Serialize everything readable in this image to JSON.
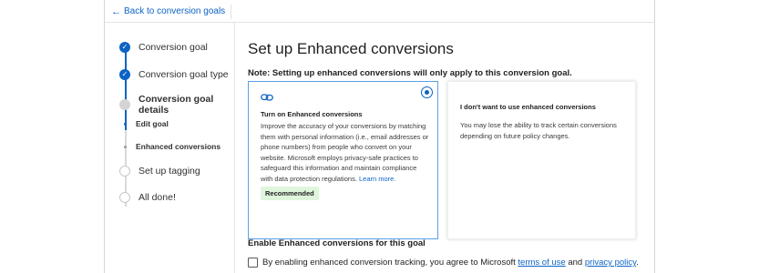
{
  "topbar": {
    "back_label": "Back to conversion goals"
  },
  "sidebar": {
    "steps": [
      {
        "label": "Conversion goal",
        "state": "done"
      },
      {
        "label": "Conversion goal type",
        "state": "done"
      },
      {
        "label": "Conversion goal details",
        "state": "current"
      },
      {
        "label": "Set up tagging",
        "state": "todo"
      },
      {
        "label": "All done!",
        "state": "todo"
      }
    ],
    "substeps": [
      {
        "label": "Edit goal",
        "state": "done"
      },
      {
        "label": "Enhanced conversions",
        "state": "current"
      }
    ]
  },
  "main": {
    "title": "Set up Enhanced conversions",
    "note": "Note: Setting up enhanced conversions will only apply to this conversion goal.",
    "cards": [
      {
        "title": "Turn on Enhanced conversions",
        "body": "Improve the accuracy of your conversions by matching them with personal information (i.e., email addresses or phone numbers) from people who convert on your website. Microsoft employs privacy-safe practices to safeguard this information and maintain compliance with data protection regulations.",
        "link": "Learn more.",
        "badge": "Recommended",
        "selected": true
      },
      {
        "title": "I don't want to use enhanced conversions",
        "body": "You may lose the ability to track certain conversions depending on future policy changes.",
        "selected": false
      }
    ],
    "enable_title": "Enable Enhanced conversions for this goal",
    "agree_prefix": "By enabling enhanced conversion tracking, you agree to Microsoft",
    "agree_terms": "terms of use",
    "agree_and": "and",
    "agree_privacy": "privacy policy",
    "agree_suffix": "."
  },
  "colors": {
    "accent": "#0b63c4",
    "badge_bg": "#dff6dd",
    "selected_border": "#5aa0e6"
  }
}
